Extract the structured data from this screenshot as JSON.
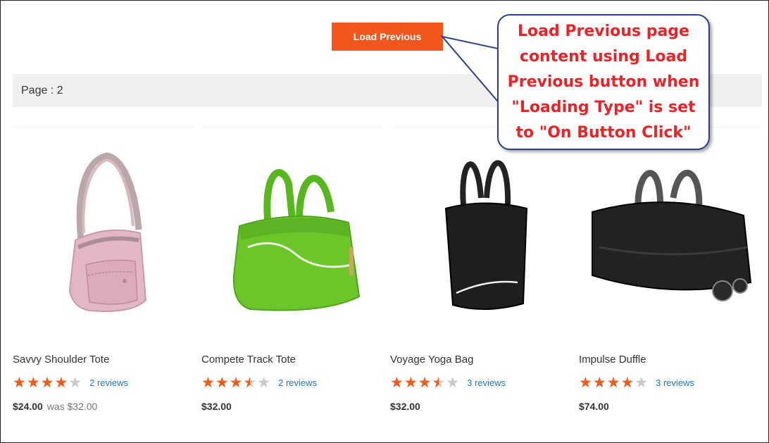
{
  "toolbar": {
    "load_previous_label": "Load Previous"
  },
  "page_indicator": {
    "label": "Page : 2"
  },
  "callout": {
    "text": "Load Previous page content using Load Previous button when \"Loading Type\" is set to \"On Button Click\""
  },
  "colors": {
    "accent": "#f2561d",
    "star": "#f05a1a",
    "link": "#1979c3",
    "callout_text": "#e62429",
    "callout_border": "#2b3f8e"
  },
  "products": [
    {
      "name": "Savvy Shoulder Tote",
      "rating": 4,
      "rating_max": 5,
      "reviews": "2 reviews",
      "price": "$24.00",
      "was": "was $32.00",
      "image_icon": "pink-shoulder-bag-icon"
    },
    {
      "name": "Compete Track Tote",
      "rating": 3.5,
      "rating_max": 5,
      "reviews": "2 reviews",
      "price": "$32.00",
      "was": "",
      "image_icon": "green-tote-bag-icon"
    },
    {
      "name": "Voyage Yoga Bag",
      "rating": 3.5,
      "rating_max": 5,
      "reviews": "3 reviews",
      "price": "$32.00",
      "was": "",
      "image_icon": "black-yoga-bag-icon"
    },
    {
      "name": "Impulse Duffle",
      "rating": 4,
      "rating_max": 5,
      "reviews": "3 reviews",
      "price": "$74.00",
      "was": "",
      "image_icon": "black-duffle-bag-icon"
    }
  ]
}
